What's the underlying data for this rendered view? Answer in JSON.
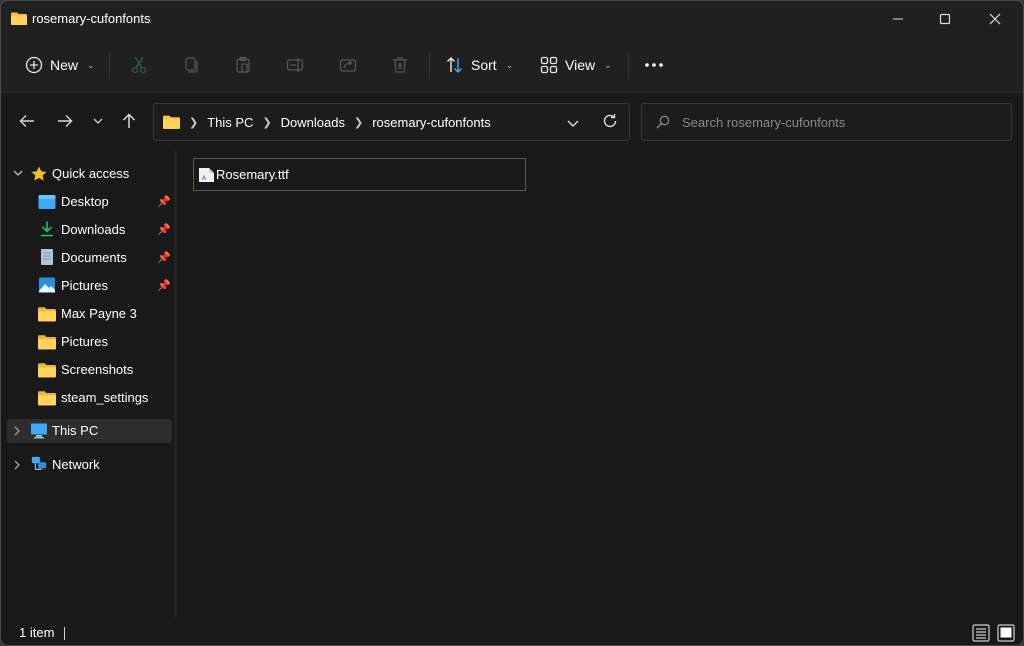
{
  "window": {
    "title": "rosemary-cufonfonts",
    "controls": {
      "minimize": "Minimize",
      "maximize": "Maximize",
      "close": "Close"
    }
  },
  "toolbar": {
    "new_label": "New",
    "sort_label": "Sort",
    "view_label": "View",
    "more_label": "See more",
    "actions": [
      {
        "name": "cut",
        "icon": "scissors-icon",
        "enabled": false
      },
      {
        "name": "copy",
        "icon": "copy-icon",
        "enabled": false
      },
      {
        "name": "paste",
        "icon": "clipboard-icon",
        "enabled": false
      },
      {
        "name": "rename",
        "icon": "rename-icon",
        "enabled": false
      },
      {
        "name": "share",
        "icon": "share-icon",
        "enabled": false
      },
      {
        "name": "delete",
        "icon": "trash-icon",
        "enabled": false
      }
    ]
  },
  "navigation": {
    "breadcrumb": [
      "This PC",
      "Downloads",
      "rosemary-cufonfonts"
    ],
    "search_placeholder": "Search rosemary-cufonfonts"
  },
  "sidebar": {
    "quick_access_label": "Quick access",
    "quick_access_items": [
      {
        "label": "Desktop",
        "icon": "desktop-icon",
        "pinned": true
      },
      {
        "label": "Downloads",
        "icon": "download-icon",
        "pinned": true
      },
      {
        "label": "Documents",
        "icon": "document-icon",
        "pinned": true
      },
      {
        "label": "Pictures",
        "icon": "pictures-icon",
        "pinned": true
      },
      {
        "label": "Max Payne 3",
        "icon": "folder-icon",
        "pinned": false
      },
      {
        "label": "Pictures",
        "icon": "folder-icon",
        "pinned": false
      },
      {
        "label": "Screenshots",
        "icon": "folder-icon",
        "pinned": false
      },
      {
        "label": "steam_settings",
        "icon": "folder-icon",
        "pinned": false
      }
    ],
    "this_pc_label": "This PC",
    "network_label": "Network"
  },
  "files": [
    {
      "name": "Rosemary.ttf",
      "icon": "font-file-icon"
    }
  ],
  "status": {
    "item_count": "1 item"
  },
  "colors": {
    "folder": "#f4c542",
    "accent_blue": "#3fa9f5",
    "download_green": "#2bb673"
  }
}
